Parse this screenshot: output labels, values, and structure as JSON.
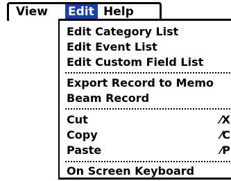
{
  "menubar": {
    "view": "View",
    "edit": "Edit",
    "help": "Help"
  },
  "edit_menu": {
    "items": [
      {
        "label": "Edit Category List"
      },
      {
        "label": "Edit Event List"
      },
      {
        "label": "Edit Custom Field List"
      },
      {
        "label": "Export Record to Memo"
      },
      {
        "label": "Beam Record"
      },
      {
        "label": "Cut",
        "shortcut": "⁄X"
      },
      {
        "label": "Copy",
        "shortcut": "⁄C"
      },
      {
        "label": "Paste",
        "shortcut": "⁄P"
      },
      {
        "label": "On Screen Keyboard"
      }
    ]
  },
  "colors": {
    "highlight": "#1a3fb0"
  }
}
